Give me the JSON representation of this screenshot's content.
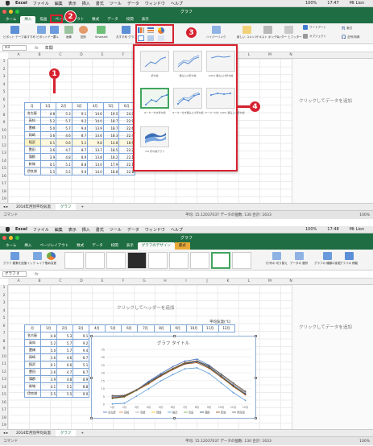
{
  "p1": {
    "menubar": {
      "items": [
        "Excel",
        "ファイル",
        "編集",
        "表示",
        "挿入",
        "書式",
        "ツール",
        "データ",
        "ウィンドウ",
        "ヘルプ"
      ],
      "status": "100%",
      "time": "17:47",
      "user": "Mt Lion"
    },
    "window_title": "グラフ",
    "tabs": [
      "ホーム",
      "挿入",
      "描画",
      "ページレイアウト",
      "数式",
      "データ",
      "校閲",
      "表示"
    ],
    "active_tab": "挿入",
    "ribbon": {
      "buttons": [
        "ピボット テーブル",
        "おすすめ ピボットテーブル",
        "表",
        "画像",
        "図形",
        "SmartArt",
        "おすすめ グラフ",
        "ハイパーリンク",
        "新しい コメント",
        "テキスト ボックス",
        "ヘッダー とフッター",
        "ワードアート",
        "オブジェクト",
        "数式",
        "記号/特殊"
      ]
    },
    "namebox": "A3",
    "formula": "年間",
    "table": {
      "header": [
        "月",
        "1月",
        "2月",
        "3月",
        "4月",
        "5月",
        "6月"
      ],
      "rows": [
        [
          "名古屋",
          "4.8",
          "5.3",
          "9.1",
          "14.6",
          "19.5",
          "24.0"
        ],
        [
          "高知",
          "5.2",
          "5.7",
          "9.2",
          "14.0",
          "18.7",
          "22.9"
        ],
        [
          "豊橋",
          "5.0",
          "5.7",
          "9.4",
          "13.9",
          "18.7",
          "22.6"
        ],
        [
          "岡崎",
          "3.6",
          "4.6",
          "8.7",
          "13.6",
          "18.3",
          "22.4"
        ],
        [
          "稲武",
          "0.1",
          "0.6",
          "5.1",
          "9.8",
          "14.8",
          "18.9"
        ],
        [
          "豊田",
          "3.6",
          "4.7",
          "8.7",
          "13.7",
          "18.5",
          "22.2"
        ],
        [
          "蒲郡",
          "3.9",
          "4.8",
          "8.9",
          "13.8",
          "18.2",
          "22.1"
        ],
        [
          "新城",
          "4.1",
          "5.1",
          "8.8",
          "13.0",
          "17.9",
          "22.1"
        ],
        [
          "伊良湖",
          "5.5",
          "5.5",
          "9.0",
          "14.0",
          "18.8",
          "22.8"
        ]
      ],
      "highlight_row": 4
    },
    "side_text": "クリックしてデータを追加",
    "chart_types": [
      {
        "label": "折れ線"
      },
      {
        "label": "積み上げ折れ線"
      },
      {
        "label": "100% 積み上げ折れ線"
      },
      {
        "label": "マーカー付き折れ線"
      },
      {
        "label": "マーカー付き積み上げ折れ線"
      },
      {
        "label": "マーカー付き 100% 積み上げ折れ線"
      },
      {
        "label": "3-D 折れ線グラフ"
      }
    ],
    "sheet_tabs": [
      "2014年月別平均気温",
      "グラフ"
    ],
    "status_left": "コマンド",
    "status_mid": "平均: 15.12037037  データの個数: 130  合計: 1633",
    "zoom": "100%",
    "badges": [
      "1",
      "2",
      "3",
      "4"
    ]
  },
  "p2": {
    "menubar": {
      "items": [
        "Excel",
        "ファイル",
        "編集",
        "表示",
        "挿入",
        "書式",
        "ツール",
        "データ",
        "ウィンドウ",
        "ヘルプ"
      ],
      "status": "100%",
      "time": "17:48",
      "user": "Mt Lion"
    },
    "window_title": "グラフ",
    "tabs": [
      "ホーム",
      "挿入",
      "ページレイアウト",
      "数式",
      "データ",
      "校閲",
      "表示",
      "グラフのデザイン",
      "書式"
    ],
    "active_tab": "グラフのデザイン",
    "ribbon": {
      "buttons": [
        "グラフ 要素を追加",
        "クイック レイアウト",
        "色の変更",
        "行/列の 切り替え",
        "データの 選択",
        "グラフの 種類の変更",
        "グラフの 移動"
      ]
    },
    "namebox": "グラフ 4",
    "header_banner": "クリックしてヘッダーを追加",
    "table_title": "平均気温(℃)",
    "table": {
      "header": [
        "月",
        "1月",
        "2月",
        "3月",
        "4月",
        "5月",
        "6月",
        "7月",
        "8月",
        "9月",
        "10月",
        "11月",
        "12月"
      ],
      "rows": [
        [
          "名古屋",
          "4.8",
          "5.3",
          "9.1"
        ],
        [
          "高知",
          "5.2",
          "5.7",
          "9.2"
        ],
        [
          "豊橋",
          "5.0",
          "5.7",
          "9.4"
        ],
        [
          "岡崎",
          "3.6",
          "4.6",
          "8.7"
        ],
        [
          "稲武",
          "0.1",
          "0.6",
          "5.1"
        ],
        [
          "豊田",
          "3.6",
          "4.7",
          "8.7"
        ],
        [
          "蒲郡",
          "3.9",
          "4.8",
          "8.9"
        ],
        [
          "新城",
          "4.1",
          "5.1",
          "8.8"
        ],
        [
          "伊良湖",
          "5.5",
          "5.5",
          "9.0"
        ]
      ]
    },
    "side_text": "クリックしてデータを追加",
    "sheet_tabs": [
      "2014年月別平均気温",
      "グラフ"
    ],
    "status_left": "コマンド",
    "status_mid": "平均: 15.12037037  データの個数: 130  合計: 1633",
    "zoom": "100%"
  },
  "chart_data": {
    "type": "line",
    "title": "グラフ タイトル",
    "categories": [
      "1月",
      "2月",
      "3月",
      "4月",
      "5月",
      "6月",
      "7月",
      "8月",
      "9月",
      "10月",
      "11月",
      "12月"
    ],
    "ylim": [
      0,
      35
    ],
    "series": [
      {
        "name": "名古屋",
        "values": [
          4.8,
          5.3,
          9.1,
          14.6,
          19.5,
          24.0,
          27.5,
          28.8,
          24.9,
          19.1,
          12.9,
          7.4
        ],
        "color": "#4472c4"
      },
      {
        "name": "高知",
        "values": [
          5.2,
          5.7,
          9.2,
          14.0,
          18.7,
          22.9,
          26.6,
          27.7,
          24.3,
          18.8,
          13.0,
          7.8
        ],
        "color": "#ed7d31"
      },
      {
        "name": "豊橋",
        "values": [
          5.0,
          5.7,
          9.4,
          13.9,
          18.7,
          22.6,
          26.3,
          27.6,
          24.2,
          18.8,
          12.9,
          7.5
        ],
        "color": "#a5a5a5"
      },
      {
        "name": "岡崎",
        "values": [
          3.6,
          4.6,
          8.7,
          13.6,
          18.3,
          22.4,
          26.2,
          27.4,
          23.6,
          17.8,
          11.5,
          6.1
        ],
        "color": "#ffc000"
      },
      {
        "name": "稲武",
        "values": [
          0.1,
          0.6,
          5.1,
          9.8,
          14.8,
          18.9,
          22.6,
          23.2,
          19.6,
          13.6,
          7.4,
          2.4
        ],
        "color": "#5b9bd5"
      },
      {
        "name": "豊田",
        "values": [
          3.6,
          4.7,
          8.7,
          13.7,
          18.5,
          22.2,
          26.0,
          27.3,
          23.5,
          17.7,
          11.6,
          6.2
        ],
        "color": "#70ad47"
      },
      {
        "name": "蒲郡",
        "values": [
          3.9,
          4.8,
          8.9,
          13.8,
          18.2,
          22.1,
          25.8,
          27.2,
          23.6,
          18.0,
          12.0,
          6.6
        ],
        "color": "#264478"
      },
      {
        "name": "新城",
        "values": [
          4.1,
          5.1,
          8.8,
          13.0,
          17.9,
          22.1,
          25.6,
          26.5,
          22.9,
          17.2,
          11.3,
          6.0
        ],
        "color": "#9e480e"
      },
      {
        "name": "伊良湖",
        "values": [
          5.5,
          5.5,
          9.0,
          14.0,
          18.8,
          22.8,
          26.4,
          27.6,
          24.5,
          19.3,
          13.6,
          8.2
        ],
        "color": "#636363"
      }
    ]
  }
}
